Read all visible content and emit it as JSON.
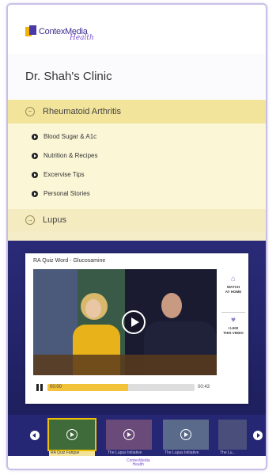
{
  "header": {
    "logo_text": "ContexMedia",
    "logo_sub": "Health"
  },
  "clinic": {
    "title": "Dr. Shah's Clinic"
  },
  "sections": [
    {
      "label": "Rheumatoid Arthritis",
      "expanded": true,
      "items": [
        {
          "label": "Blood Sugar & A1c"
        },
        {
          "label": "Nutrition & Recipes"
        },
        {
          "label": "Excervise Tips"
        },
        {
          "label": "Personal Stories"
        }
      ]
    },
    {
      "label": "Lupus",
      "expanded": false
    }
  ],
  "video": {
    "title": "RA Quiz Word - Glucosamine",
    "elapsed": "00:00",
    "duration": "00:43",
    "progress_fraction": 0.55,
    "actions": [
      {
        "icon": "home-icon",
        "label_line1": "WATCH",
        "label_line2": "AT HOME"
      },
      {
        "icon": "heart-icon",
        "label_line1": "I LIKE",
        "label_line2": "THIS VIDEO"
      }
    ]
  },
  "carousel": {
    "thumbs": [
      {
        "caption": "RA Quiz Fatigue",
        "selected": true,
        "color": "#3f6b3a"
      },
      {
        "caption": "The Lupus Initiative",
        "selected": false,
        "color": "#6a4a78"
      },
      {
        "caption": "The Lupus Initiative",
        "selected": false,
        "color": "#5a6a8a"
      },
      {
        "caption": "The Lu...",
        "selected": false,
        "color": "#4a4e7a"
      }
    ]
  },
  "footer": {
    "logo_line1": "ContexMedia",
    "logo_line2": "Health"
  },
  "colors": {
    "accent_yellow": "#f3e49b",
    "overlay_blue": "#252674",
    "brand_purple": "#3c2f91"
  }
}
